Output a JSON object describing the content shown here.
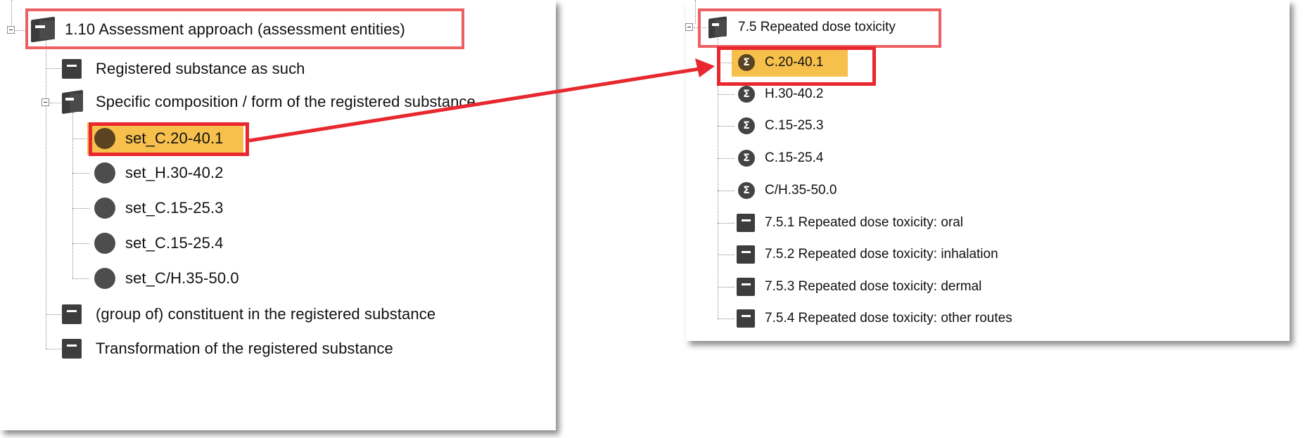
{
  "left_tree": {
    "root": {
      "label": "1.10 Assessment approach (assessment entities)",
      "icon": "folder-icon"
    },
    "items": [
      {
        "label": "Registered substance as such",
        "icon": "section-icon"
      },
      {
        "label": "Specific composition / form of the registered substance",
        "icon": "folder-icon"
      },
      {
        "label": "(group of) constituent in the registered substance",
        "icon": "section-icon"
      },
      {
        "label": "Transformation of the registered substance",
        "icon": "section-icon"
      }
    ],
    "children": [
      {
        "label": "set_C.20-40.1",
        "icon": "circle-icon",
        "selected": true
      },
      {
        "label": "set_H.30-40.2",
        "icon": "circle-icon",
        "selected": false
      },
      {
        "label": "set_C.15-25.3",
        "icon": "circle-icon",
        "selected": false
      },
      {
        "label": "set_C.15-25.4",
        "icon": "circle-icon",
        "selected": false
      },
      {
        "label": "set_C/H.35-50.0",
        "icon": "circle-icon",
        "selected": false
      }
    ]
  },
  "right_tree": {
    "root": {
      "label": "7.5 Repeated dose toxicity",
      "icon": "folder-icon"
    },
    "items": [
      {
        "label": "C.20-40.1",
        "icon": "sigma-icon",
        "selected": true
      },
      {
        "label": "H.30-40.2",
        "icon": "sigma-icon",
        "selected": false
      },
      {
        "label": "C.15-25.3",
        "icon": "sigma-icon",
        "selected": false
      },
      {
        "label": "C.15-25.4",
        "icon": "sigma-icon",
        "selected": false
      },
      {
        "label": "C/H.35-50.0",
        "icon": "sigma-icon",
        "selected": false
      },
      {
        "label": "7.5.1 Repeated dose toxicity: oral",
        "icon": "section-icon"
      },
      {
        "label": "7.5.2 Repeated dose toxicity: inhalation",
        "icon": "section-icon"
      },
      {
        "label": "7.5.3 Repeated dose toxicity: dermal",
        "icon": "section-icon"
      },
      {
        "label": "7.5.4 Repeated dose toxicity: other routes",
        "icon": "section-icon"
      }
    ]
  },
  "sigma_glyph": "Σ",
  "colors": {
    "highlight": "#f7c04d",
    "callout_red": "#e8282e",
    "icon_dark": "#3d3d3d"
  }
}
